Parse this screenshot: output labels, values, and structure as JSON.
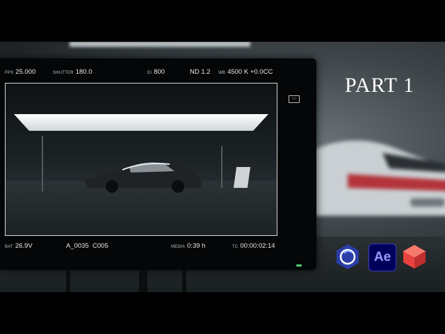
{
  "title": "PART 1",
  "monitor": {
    "top": [
      {
        "label": "FPS",
        "value": "25.000"
      },
      {
        "label": "SHUTTER",
        "value": "180.0"
      },
      {
        "label": "EI",
        "value": "800"
      },
      {
        "label": "",
        "value": "ND 1.2"
      },
      {
        "label": "WB",
        "value": "4500 K +0.0CC"
      }
    ],
    "bottom": [
      {
        "label": "BAT",
        "value": "26.9V"
      },
      {
        "label": "",
        "value": "A_0035  C005"
      },
      {
        "label": "MEDIA",
        "value": "0:39 h"
      },
      {
        "label": "TC",
        "value": "00:00:02:14"
      }
    ]
  },
  "apps": {
    "after_effects": "Ae",
    "icons": [
      "cinema4d-icon",
      "after-effects-icon",
      "redshift-icon"
    ]
  },
  "colors": {
    "ae_bg": "#00005b",
    "ae_fg": "#9999ff",
    "tally": "#4fd17a",
    "redshift": "#e8433f",
    "c4d": "#2b3ea8"
  }
}
